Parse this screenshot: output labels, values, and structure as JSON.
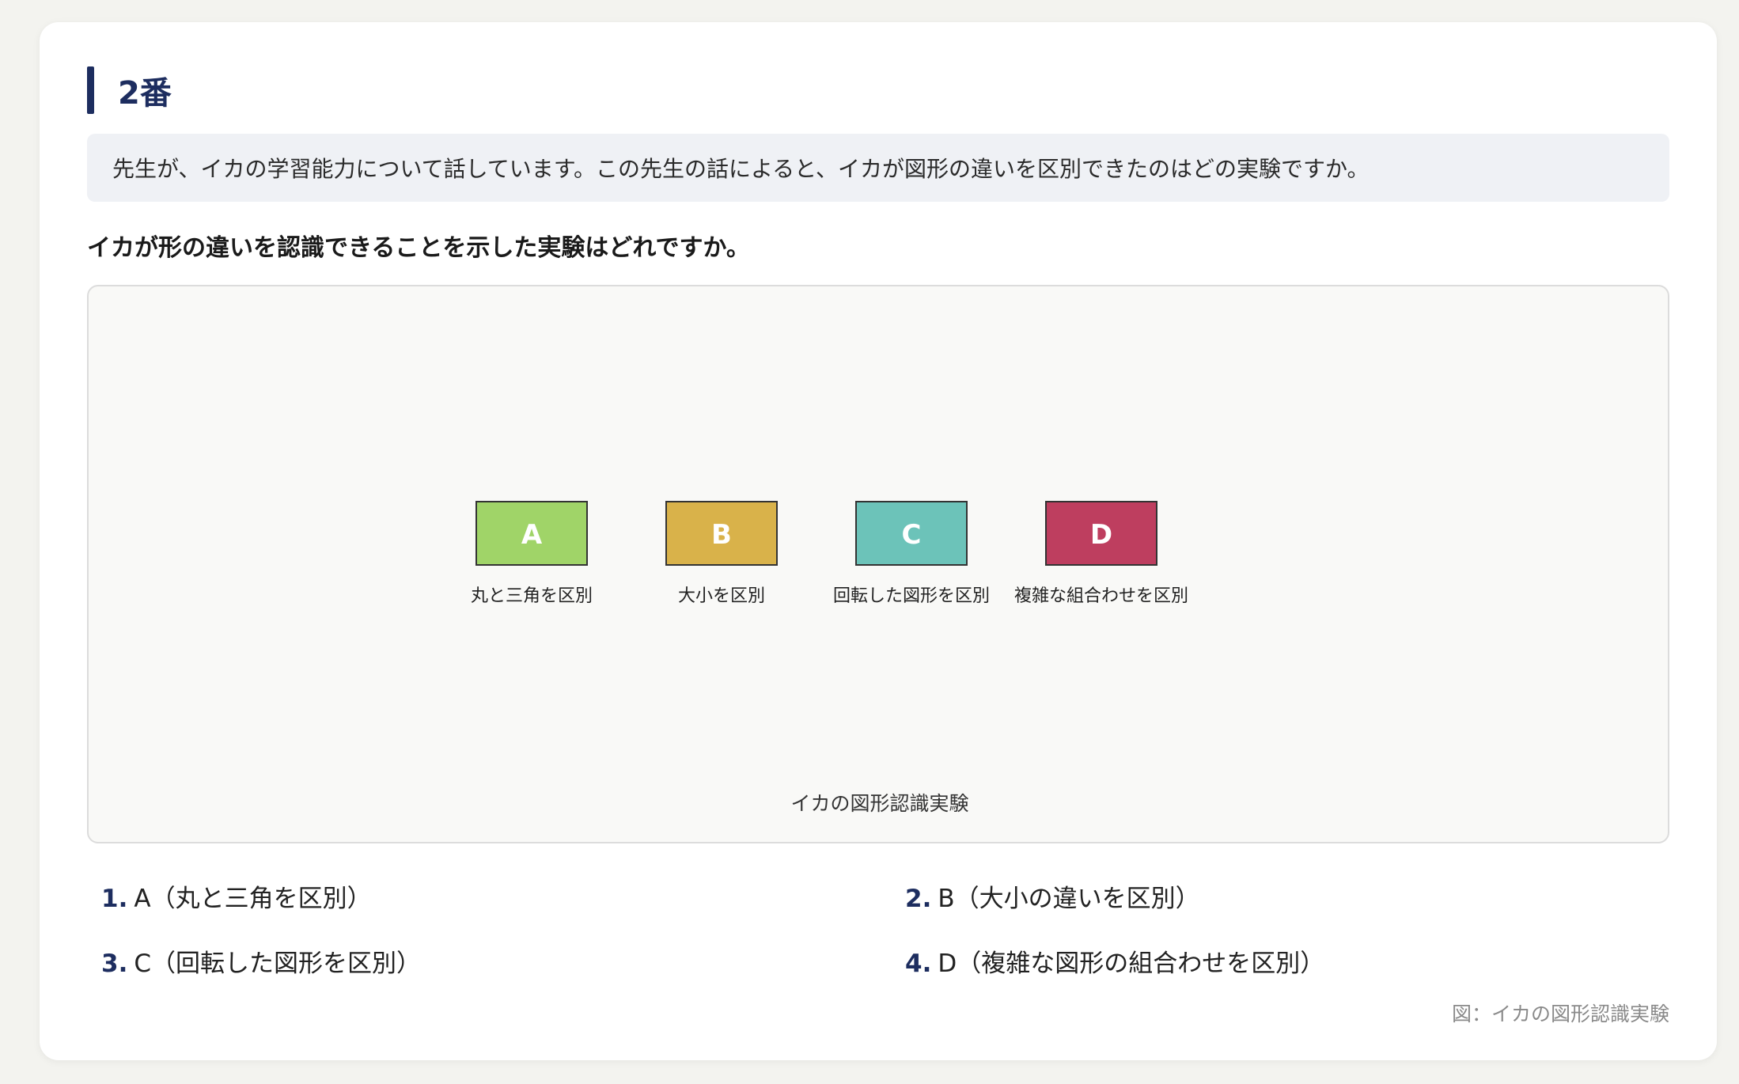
{
  "question_number": "2番",
  "instruction": "先生が、イカの学習能力について話しています。この先生の話によると、イカが図形の違いを区別できたのはどの実験ですか。",
  "question": "イカが形の違いを認識できることを示した実験はどれですか。",
  "figure": {
    "title": "イカの図形認識実験",
    "boxes": [
      {
        "letter": "A",
        "label": "丸と三角を区別",
        "color": "#a0d468"
      },
      {
        "letter": "B",
        "label": "大小を区別",
        "color": "#d9b24a"
      },
      {
        "letter": "C",
        "label": "回転した図形を区別",
        "color": "#6cc3b9"
      },
      {
        "letter": "D",
        "label": "複雑な組合わせを区別",
        "color": "#be3e5f"
      }
    ]
  },
  "options": [
    {
      "num": "1.",
      "text": "A（丸と三角を区別）"
    },
    {
      "num": "2.",
      "text": "B（大小の違いを区別）"
    },
    {
      "num": "3.",
      "text": "C（回転した図形を区別）"
    },
    {
      "num": "4.",
      "text": "D（複雑な図形の組合わせを区別）"
    }
  ],
  "caption": "図：イカの図形認識実験"
}
